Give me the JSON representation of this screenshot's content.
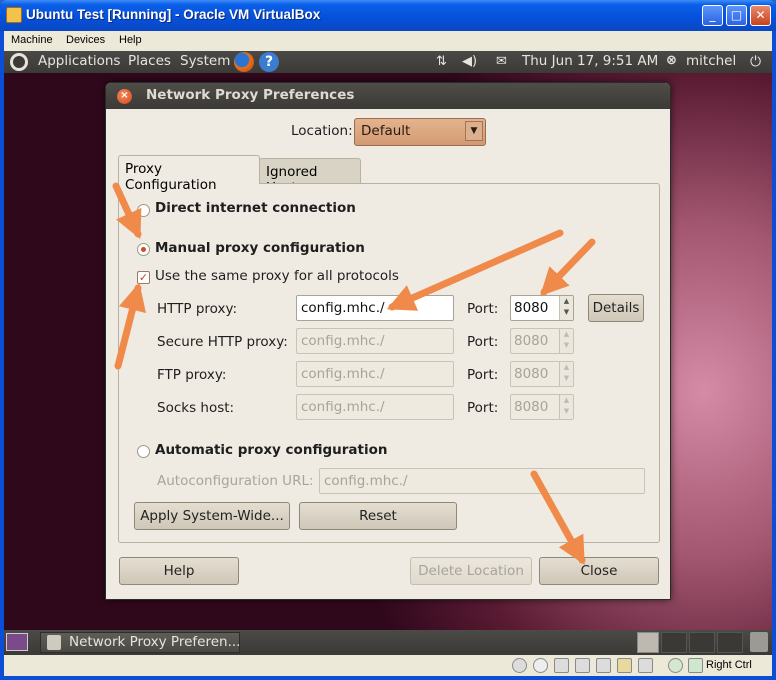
{
  "window": {
    "title": "Ubuntu Test [Running] - Oracle VM VirtualBox",
    "min": "_",
    "max": "□",
    "close": "✕"
  },
  "vbox_menu": [
    "Machine",
    "Devices",
    "Help"
  ],
  "guest_panel": {
    "menus": [
      "Applications",
      "Places",
      "System"
    ],
    "clock": "Thu Jun 17,  9:51 AM",
    "user": "mitchel"
  },
  "dialog": {
    "title": "Network Proxy Preferences",
    "location_label": "Location:",
    "location_value": "Default",
    "tabs": [
      "Proxy Configuration",
      "Ignored Hosts"
    ],
    "direct_label": "Direct internet connection",
    "manual_label": "Manual proxy configuration",
    "same_proxy_label": "Use the same proxy for all protocols",
    "rows": [
      {
        "label": "HTTP proxy:",
        "host": "config.mhc./",
        "port_label": "Port:",
        "port": "8080"
      },
      {
        "label": "Secure HTTP proxy:",
        "host": "config.mhc./",
        "port_label": "Port:",
        "port": "8080"
      },
      {
        "label": "FTP proxy:",
        "host": "config.mhc./",
        "port_label": "Port:",
        "port": "8080"
      },
      {
        "label": "Socks host:",
        "host": "config.mhc./",
        "port_label": "Port:",
        "port": "8080"
      }
    ],
    "details_label": "Details",
    "auto_label": "Automatic proxy configuration",
    "autoconfig_label": "Autoconfiguration URL:",
    "autoconfig_value": "config.mhc./",
    "apply_label": "Apply System-Wide...",
    "reset_label": "Reset",
    "help_label": "Help",
    "delete_label": "Delete Location",
    "close_label": "Close"
  },
  "guest_taskbar": {
    "task_label": "Network Proxy Preferen..."
  },
  "statusbar": {
    "host_key": "Right Ctrl"
  },
  "colors": {
    "xp_title": "#0650d8",
    "accent": "#d24a1e",
    "arrow": "#f08a4a"
  }
}
